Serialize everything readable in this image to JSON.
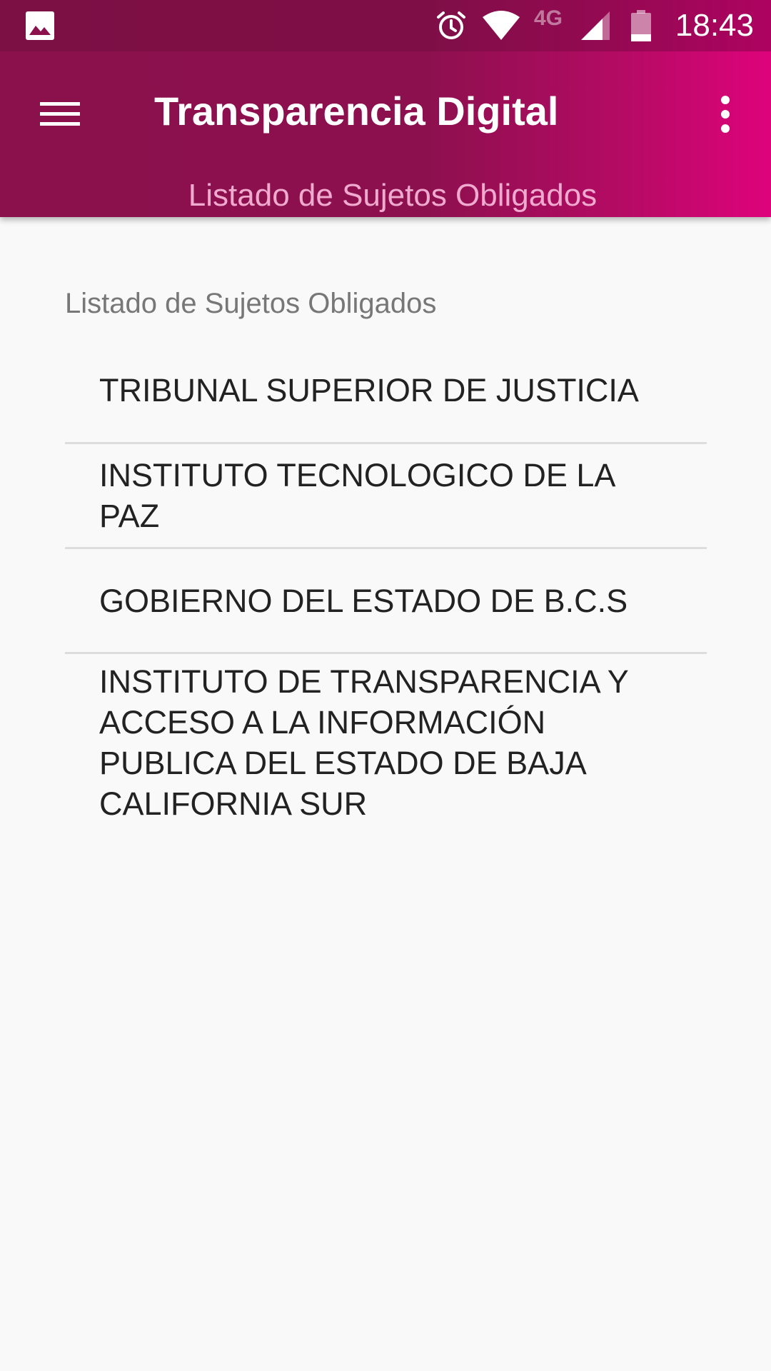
{
  "status_bar": {
    "time": "18:43",
    "network": "4G",
    "icons": [
      "image-icon",
      "alarm-icon",
      "wifi-icon",
      "signal-icon",
      "battery-icon"
    ]
  },
  "app_bar": {
    "title": "Transparencia Digital",
    "subtitle": "Listado de Sujetos Obligados",
    "menu_icon": "hamburger-menu-icon",
    "overflow_icon": "more-vert-icon",
    "colors": {
      "gradient_start": "#8a114c",
      "gradient_end": "#de037b",
      "subtitle": "#f0a9cf"
    }
  },
  "list": {
    "header": "Listado de Sujetos Obligados",
    "items": [
      {
        "label": "TRIBUNAL SUPERIOR DE JUSTICIA"
      },
      {
        "label": "INSTITUTO TECNOLOGICO DE LA PAZ"
      },
      {
        "label": "GOBIERNO DEL ESTADO DE B.C.S"
      },
      {
        "label": "INSTITUTO DE TRANSPARENCIA Y ACCESO A LA INFORMACIÓN PUBLICA DEL ESTADO DE BAJA CALIFORNIA SUR"
      }
    ]
  }
}
